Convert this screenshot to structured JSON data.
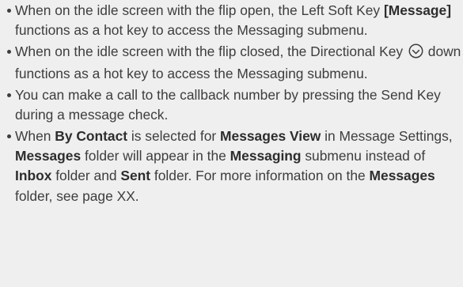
{
  "tips": [
    {
      "id": "message-hotkey",
      "segments": [
        {
          "text": "When on the idle screen with the flip open, the Left Soft Key ",
          "bold": false
        },
        {
          "text": "[Message]",
          "bold": true
        },
        {
          "text": " functions as a hot key to access the Messaging submenu.",
          "bold": false
        }
      ]
    },
    {
      "id": "directional-hotkey",
      "segments": [
        {
          "text": "When on the idle screen with the flip closed, the Directional Key ",
          "bold": false
        },
        {
          "icon": "directional-key-down-icon"
        },
        {
          "text": " down functions as a hot key to access the Messaging submenu.",
          "bold": false
        }
      ]
    },
    {
      "id": "callback",
      "segments": [
        {
          "text": "You can make a call to the callback number by pressing the Send Key during a message check.",
          "bold": false
        }
      ]
    },
    {
      "id": "by-contact",
      "segments": [
        {
          "text": "When ",
          "bold": false
        },
        {
          "text": "By Contact",
          "bold": true
        },
        {
          "text": " is selected for ",
          "bold": false
        },
        {
          "text": "Messages View",
          "bold": true
        },
        {
          "text": " in Message Settings, ",
          "bold": false
        },
        {
          "text": "Messages",
          "bold": true
        },
        {
          "text": " folder will appear in the ",
          "bold": false
        },
        {
          "text": "Messaging",
          "bold": true
        },
        {
          "text": " submenu instead of ",
          "bold": false
        },
        {
          "text": "Inbox",
          "bold": true
        },
        {
          "text": " folder and ",
          "bold": false
        },
        {
          "text": "Sent",
          "bold": true
        },
        {
          "text": " folder. For more information on the ",
          "bold": false
        },
        {
          "text": "Messages",
          "bold": true
        },
        {
          "text": " folder, see page XX.",
          "bold": false
        }
      ]
    }
  ]
}
